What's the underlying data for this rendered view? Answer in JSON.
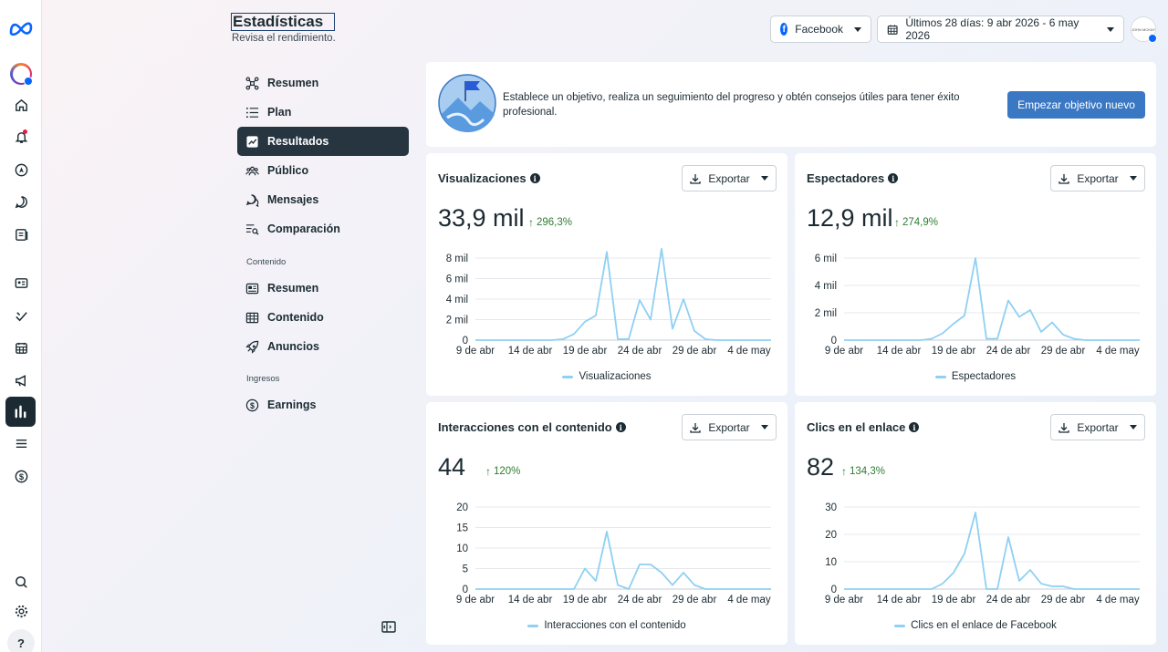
{
  "header": {
    "title": "Estadísticas",
    "subtitle": "Revisa el rendimiento.",
    "platform": "Facebook",
    "date_range": "Últimos 28 días: 9 abr 2026 - 6 may 2026",
    "avatar_text": "JOHN MCKAY"
  },
  "rail": {
    "icons": [
      "meta-logo-icon",
      "profile-icon",
      "home-icon",
      "bell-icon",
      "compass-icon",
      "chat-icon",
      "pages-icon",
      "contacts-icon",
      "planner-icon",
      "calendar-icon",
      "megaphone-icon",
      "insights-icon",
      "menu-icon",
      "dollar-icon",
      "search-icon",
      "gear-icon",
      "help-icon"
    ],
    "help_label": "?"
  },
  "subnav": {
    "items": [
      "Resumen",
      "Plan",
      "Resultados",
      "Público",
      "Mensajes",
      "Comparación"
    ],
    "content_label": "Contenido",
    "content_items": [
      "Resumen",
      "Contenido",
      "Anuncios"
    ],
    "income_label": "Ingresos",
    "income_items": [
      "Earnings"
    ]
  },
  "goal": {
    "text": "Establece un objetivo, realiza un seguimiento del progreso y obtén consejos útiles para tener éxito profesional.",
    "button": "Empezar objetivo nuevo"
  },
  "export_label": "Exportar",
  "colors": {
    "accent": "#3b78c3",
    "line": "#8fd0f3",
    "positive": "#2f7d32",
    "active_nav": "#263540"
  },
  "chart_data": [
    {
      "type": "line",
      "title": "Visualizaciones",
      "value": "33,9 mil",
      "change": "296,3%",
      "x_ticks": [
        "9 de abr",
        "14 de abr",
        "19 de abr",
        "24 de abr",
        "29 de abr",
        "4 de may"
      ],
      "y_ticks": [
        "0",
        "2 mil",
        "4 mil",
        "6 mil",
        "8 mil"
      ],
      "ylim": [
        0,
        8000
      ],
      "series": [
        {
          "name": "Visualizaciones",
          "values": [
            0,
            0,
            0,
            0,
            0,
            0,
            0,
            0,
            100,
            600,
            1800,
            2400,
            8600,
            100,
            100,
            3900,
            2000,
            8900,
            1100,
            4000,
            900,
            100,
            0,
            0,
            0,
            0,
            0,
            0
          ]
        }
      ]
    },
    {
      "type": "line",
      "title": "Espectadores",
      "value": "12,9 mil",
      "change": "274,9%",
      "x_ticks": [
        "9 de abr",
        "14 de abr",
        "19 de abr",
        "24 de abr",
        "29 de abr",
        "4 de may"
      ],
      "y_ticks": [
        "0",
        "2 mil",
        "4 mil",
        "6 mil"
      ],
      "ylim": [
        0,
        6000
      ],
      "series": [
        {
          "name": "Espectadores",
          "values": [
            0,
            0,
            0,
            0,
            0,
            0,
            0,
            0,
            100,
            500,
            1200,
            1800,
            6000,
            100,
            100,
            2900,
            1700,
            2200,
            600,
            1300,
            400,
            100,
            0,
            0,
            0,
            0,
            0,
            0
          ]
        }
      ]
    },
    {
      "type": "line",
      "title": "Interacciones con el contenido",
      "value": "44",
      "change": "120%",
      "x_ticks": [
        "9 de abr",
        "14 de abr",
        "19 de abr",
        "24 de abr",
        "29 de abr",
        "4 de may"
      ],
      "y_ticks": [
        "0",
        "5",
        "10",
        "15",
        "20"
      ],
      "ylim": [
        0,
        20
      ],
      "series": [
        {
          "name": "Interacciones con el contenido",
          "values": [
            0,
            0,
            0,
            0,
            0,
            0,
            0,
            0,
            0,
            0,
            5,
            2,
            14,
            1,
            0,
            6,
            6,
            4,
            1,
            4,
            1,
            0,
            0,
            0,
            0,
            0,
            0,
            0
          ]
        }
      ]
    },
    {
      "type": "line",
      "title": "Clics en el enlace",
      "value": "82",
      "change": "134,3%",
      "x_ticks": [
        "9 de abr",
        "14 de abr",
        "19 de abr",
        "24 de abr",
        "29 de abr",
        "4 de may"
      ],
      "y_ticks": [
        "0",
        "10",
        "20",
        "30"
      ],
      "ylim": [
        0,
        30
      ],
      "series": [
        {
          "name": "Clics en el enlace de Facebook",
          "values": [
            0,
            0,
            0,
            0,
            0,
            0,
            0,
            0,
            0,
            2,
            6,
            13,
            28,
            0,
            0,
            19,
            3,
            7,
            2,
            1,
            1,
            0,
            0,
            0,
            0,
            0,
            0,
            0
          ]
        }
      ]
    }
  ]
}
